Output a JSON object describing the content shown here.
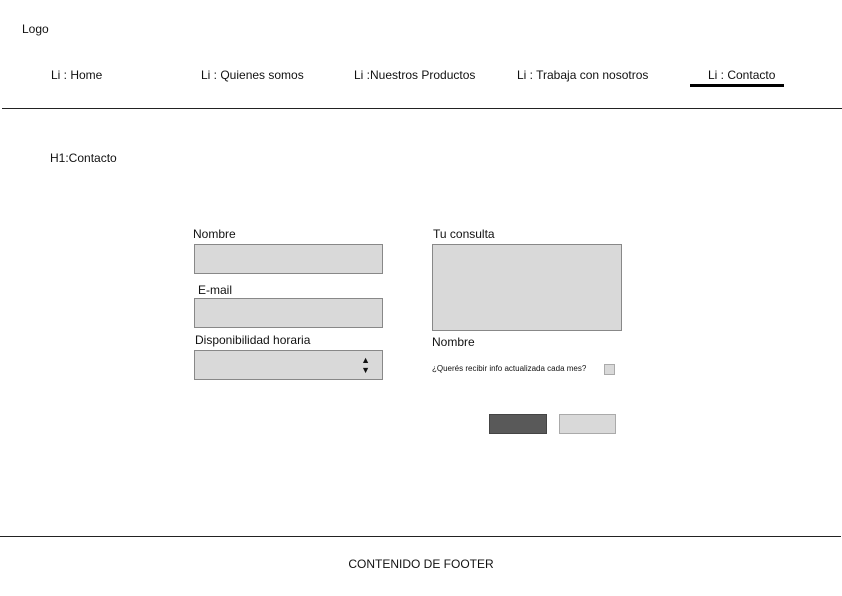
{
  "header": {
    "logo": "Logo"
  },
  "nav": {
    "items": [
      {
        "label": "Li : Home"
      },
      {
        "label": "Li : Quienes somos"
      },
      {
        "label": "Li :Nuestros Productos"
      },
      {
        "label": "Li : Trabaja con nosotros"
      },
      {
        "label": "Li : Contacto",
        "active": true
      }
    ]
  },
  "main": {
    "title": "H1:Contacto"
  },
  "form": {
    "name_label": "Nombre",
    "name_value": "",
    "email_label": "E-mail",
    "email_value": "",
    "availability_label": "Disponibilidad horaria",
    "availability_value": "",
    "query_label": "Tu consulta",
    "query_value": "",
    "second_name_label": "Nombre",
    "newsletter_label": "¿Querés recibir info actualizada cada mes?",
    "newsletter_checked": false,
    "select_icon": "up-down-arrows-icon"
  },
  "footer": {
    "text": "CONTENIDO DE FOOTER"
  },
  "colors": {
    "field_bg": "#d9d9d9",
    "primary_button": "#595959",
    "secondary_button": "#d9d9d9",
    "active_underline": "#000000"
  }
}
